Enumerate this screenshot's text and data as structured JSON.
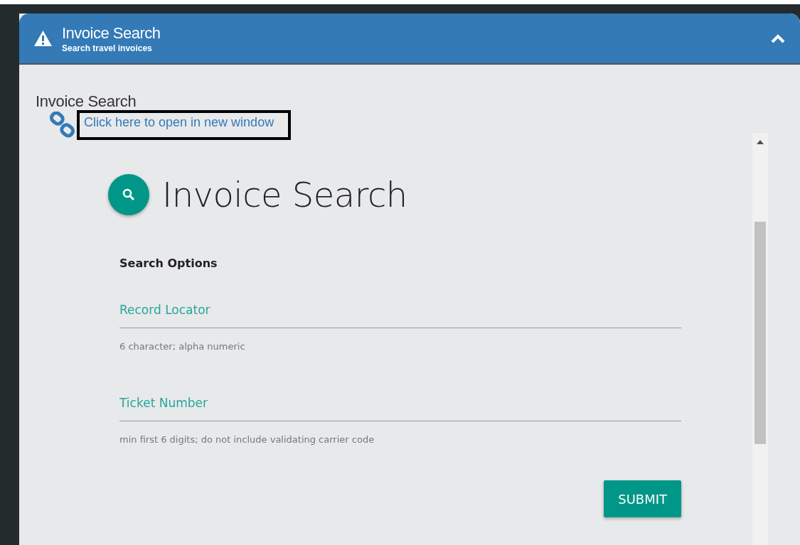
{
  "panel": {
    "title": "Invoice Search",
    "subtitle": "Search travel invoices",
    "expanded": true
  },
  "page_title": "Invoice Search",
  "link": "Click here to open in new window",
  "frame": {
    "heading": "Invoice Search",
    "section": "Search Options",
    "fields": [
      {
        "placeholder": "Record Locator",
        "hint": "6 character; alpha numeric"
      },
      {
        "placeholder": "Ticket Number",
        "hint": "min first 6 digits; do not include validating carrier code"
      }
    ],
    "button": "SUBMIT"
  }
}
